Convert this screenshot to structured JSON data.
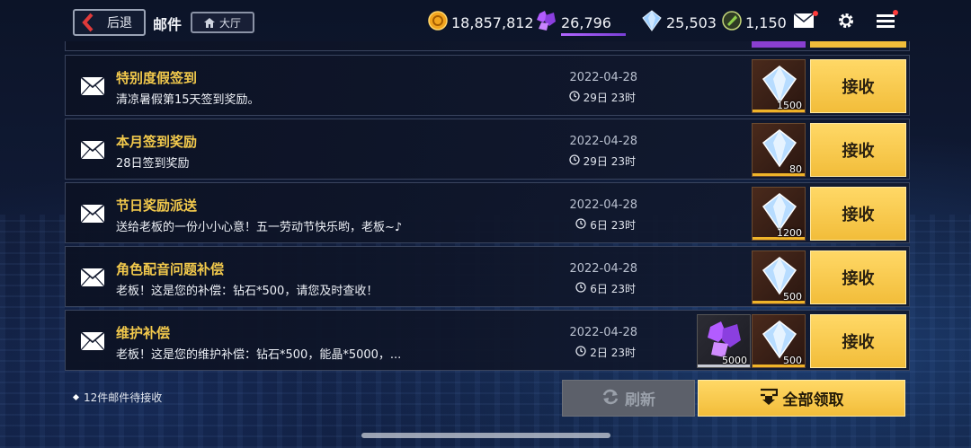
{
  "header": {
    "back_label": "后退",
    "title": "邮件",
    "lobby_label": "大厅"
  },
  "currencies": {
    "gold": "18,857,812",
    "crystal": "26,796",
    "diamond": "25,503",
    "gem": "1,150"
  },
  "mails": [
    {
      "title": "特别度假签到",
      "body": "清凉暑假第15天签到奖励。",
      "date": "2022-04-28",
      "remaining": "29日 23时",
      "rewards": [
        {
          "icon": "diamond-icon",
          "qty": "1500"
        }
      ],
      "action": "接收"
    },
    {
      "title": "本月签到奖励",
      "body": "28日签到奖励",
      "date": "2022-04-28",
      "remaining": "29日 23时",
      "rewards": [
        {
          "icon": "diamond-icon",
          "qty": "80"
        }
      ],
      "action": "接收"
    },
    {
      "title": "节日奖励派送",
      "body": "送给老板的一份小小心意！五一劳动节快乐哟，老板~♪",
      "date": "2022-04-28",
      "remaining": "6日 23时",
      "rewards": [
        {
          "icon": "diamond-icon",
          "qty": "1200"
        }
      ],
      "action": "接收"
    },
    {
      "title": "角色配音问题补偿",
      "body": "老板！这是您的补偿：钻石*500，请您及时查收！",
      "date": "2022-04-28",
      "remaining": "6日 23时",
      "rewards": [
        {
          "icon": "diamond-icon",
          "qty": "500"
        }
      ],
      "action": "接收"
    },
    {
      "title": "维护补偿",
      "body": "老板！这是您的维护补偿：钻石*500，能晶*5000，...",
      "date": "2022-04-28",
      "remaining": "2日 23时",
      "rewards": [
        {
          "icon": "crystal-icon",
          "qty": "5000"
        },
        {
          "icon": "diamond-icon",
          "qty": "500"
        }
      ],
      "action": "接收"
    }
  ],
  "footer": {
    "pending_note": "12件邮件待接收",
    "refresh_label": "刷新",
    "claim_all_label": "全部领取"
  },
  "colors": {
    "accent_gold": "#f2c94c",
    "button_yellow": "#f5c542",
    "disabled_gray": "#5c606a"
  }
}
